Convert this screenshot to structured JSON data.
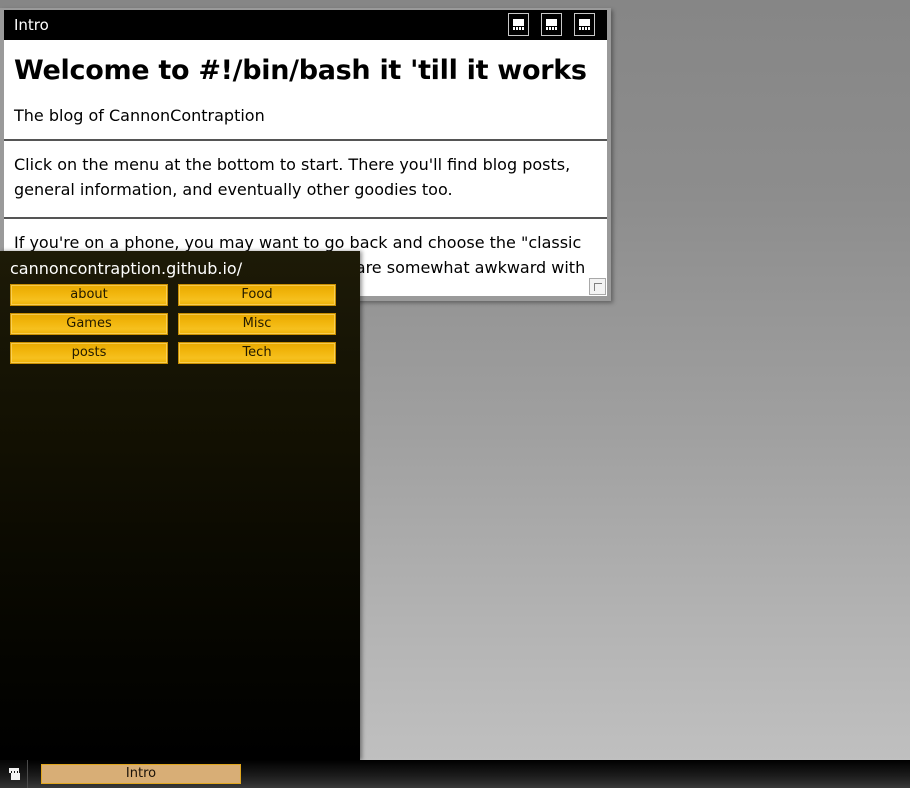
{
  "window": {
    "title": "Intro",
    "titlebar_buttons": [
      {
        "name": "minimize-button",
        "icon": "window-minimize-icon"
      },
      {
        "name": "maximize-button",
        "icon": "window-maximize-icon"
      },
      {
        "name": "close-button",
        "icon": "window-close-icon"
      }
    ],
    "resize_grip": "resize-grip"
  },
  "page": {
    "heading": "Welcome to #!/bin/bash it 'till it works",
    "subtitle": "The blog of CannonContraption",
    "paragraphs": [
      "Click on the menu at the bottom to start. There you'll find blog posts, general information, and eventually other goodies too.",
      "If you're on a phone, you may want to go back and choose the \"classic site\". Unfortunately, touch-only interfaces are somewhat awkward with the desktop"
    ]
  },
  "menu_panel": {
    "url": "cannoncontraption.github.io/",
    "rows": [
      [
        {
          "label": "about"
        },
        {
          "label": "Food"
        }
      ],
      [
        {
          "label": "Games"
        },
        {
          "label": "Misc"
        }
      ],
      [
        {
          "label": "posts"
        },
        {
          "label": "Tech"
        }
      ]
    ]
  },
  "taskbar": {
    "launcher_icon": "application-window-icon",
    "tasks": [
      {
        "label": "Intro"
      }
    ]
  },
  "colors": {
    "accent_gold": "#f1b50c",
    "task_button": "#d8ae76",
    "panel_dark": "#1d1a07",
    "titlebar": "#000000"
  }
}
